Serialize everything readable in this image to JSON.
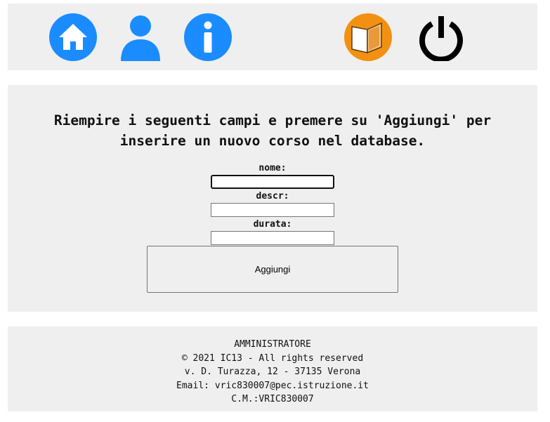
{
  "nav": {
    "items": [
      {
        "icon": "home-icon",
        "color": "#1a8cff"
      },
      {
        "icon": "user-icon",
        "color": "#1a8cff"
      },
      {
        "icon": "info-icon",
        "color": "#1a8cff"
      },
      {
        "icon": "book-icon",
        "color": "#f29111"
      },
      {
        "icon": "power-icon",
        "color": "#000000"
      }
    ]
  },
  "form": {
    "instructions_line1": "Riempire i seguenti campi e premere su 'Aggiungi' per",
    "instructions_line2": "inserire un nuovo corso nel database.",
    "fields": [
      {
        "label": "nome:",
        "value": ""
      },
      {
        "label": "descr:",
        "value": ""
      },
      {
        "label": "durata:",
        "value": ""
      }
    ],
    "submit_label": "Aggiungi"
  },
  "footer": {
    "role": "AMMINISTRATORE",
    "copyright": "© 2021 IC13 - All rights reserved",
    "address": "v. D. Turazza, 12 - 37135 Verona",
    "email": "Email: vric830007@pec.istruzione.it",
    "code": "C.M.:VRIC830007"
  }
}
